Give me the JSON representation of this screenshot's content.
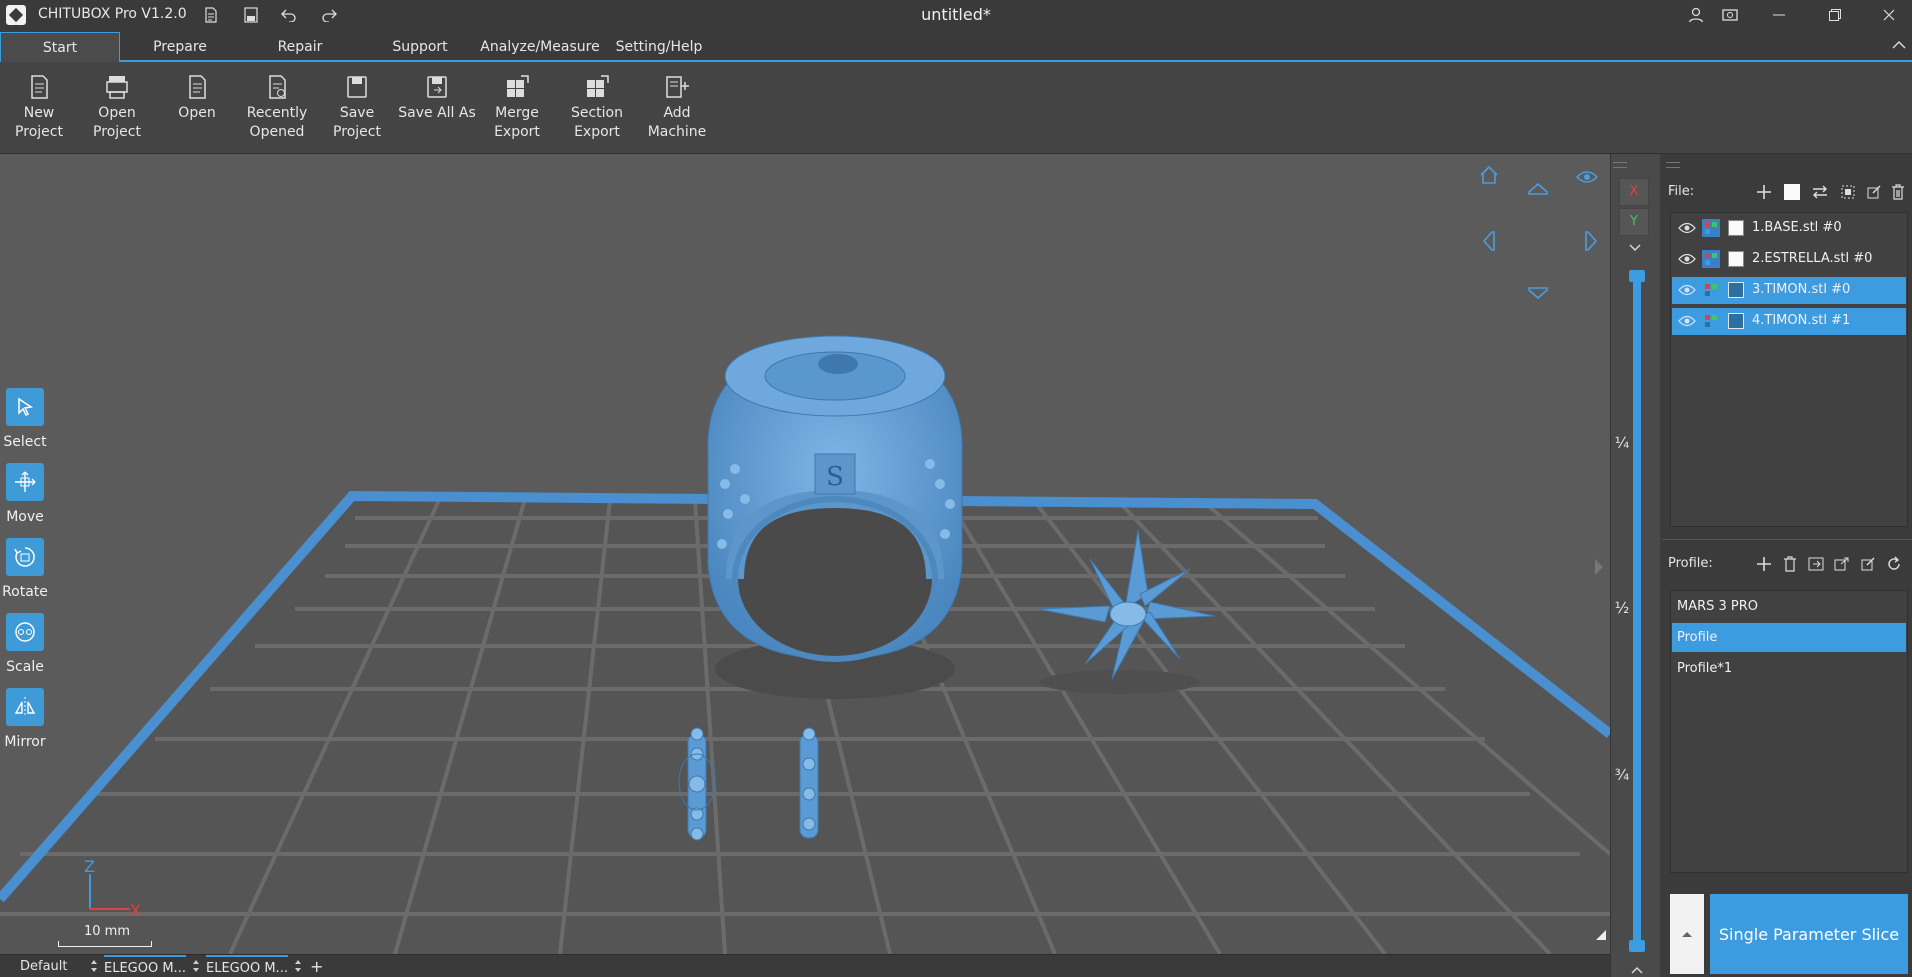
{
  "app": {
    "name": "CHITUBOX Pro V1.2.0",
    "document_title": "untitled*"
  },
  "menu": {
    "tabs": [
      {
        "label": "Start"
      },
      {
        "label": "Prepare"
      },
      {
        "label": "Repair"
      },
      {
        "label": "Support"
      },
      {
        "label": "Analyze/Measure"
      },
      {
        "label": "Setting/Help"
      }
    ]
  },
  "ribbon": {
    "new_project": "New Project",
    "open_project": [
      "Open",
      "Project"
    ],
    "open": "Open",
    "recently_opened": [
      "Recently",
      "Opened"
    ],
    "save_project": "Save Project",
    "save_all_as": "Save All As",
    "merge_export": [
      "Merge",
      "Export"
    ],
    "section_export": [
      "Section",
      "Export"
    ],
    "add_machine": [
      "Add",
      "Machine"
    ]
  },
  "tools": {
    "select": "Select",
    "move": "Move",
    "rotate": "Rotate",
    "scale": "Scale",
    "mirror": "Mirror"
  },
  "viewport": {
    "scale_label": "10 mm",
    "axis_z": "Z",
    "axis_x": "X"
  },
  "slider": {
    "axis_x": "X",
    "axis_y": "Y",
    "marks": [
      "¼",
      "½",
      "¾"
    ]
  },
  "files": {
    "label": "File:",
    "items": [
      {
        "name": "1.BASE.stl #0",
        "selected": false
      },
      {
        "name": "2.ESTRELLA.stl #0",
        "selected": false
      },
      {
        "name": "3.TIMON.stl #0",
        "selected": true
      },
      {
        "name": "4.TIMON.stl #1",
        "selected": true
      }
    ]
  },
  "profile": {
    "label": "Profile:",
    "items": [
      {
        "name": "MARS 3 PRO",
        "selected": false
      },
      {
        "name": "Profile",
        "selected": true
      },
      {
        "name": "Profile*1",
        "selected": false
      }
    ]
  },
  "slice": {
    "label": "Single Parameter Slice"
  },
  "status": {
    "tabs": [
      {
        "label": "Default"
      },
      {
        "label": "ELEGOO M..."
      },
      {
        "label": "ELEGOO M..."
      }
    ]
  },
  "colors": {
    "accent": "#3d9be0",
    "model": "#5b9bd5",
    "plate": "#4a8fd0"
  }
}
